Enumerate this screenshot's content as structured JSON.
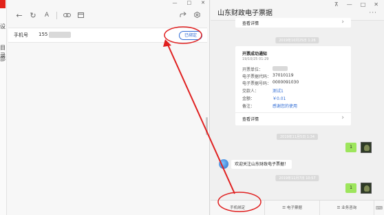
{
  "bg_app": {
    "badge_label": "",
    "side_texts": [
      "目录",
      "设",
      "部"
    ]
  },
  "left_window": {
    "controls": [
      "—",
      "□",
      "✕"
    ],
    "toolbar_icons": [
      "back-icon",
      "refresh-icon",
      "font-icon",
      "link-icon",
      "calendar-icon",
      "share-icon",
      "settings-icon"
    ],
    "phone_label": "手机号",
    "phone_value": "155",
    "bound_button": "已绑定"
  },
  "right_window": {
    "title": "山东财政电子票据",
    "controls": [
      "⊼",
      "—",
      "□",
      "✕"
    ],
    "more": "···",
    "view_detail": "查看详情",
    "time1": "2019年10月25日 1:26",
    "notice": {
      "title": "开票成功通知",
      "date": "19/10/25 01:29",
      "fields": [
        {
          "label": "开票单位：",
          "value": ""
        },
        {
          "label": "电子票据代码：",
          "value": "37010119"
        },
        {
          "label": "电子票据号码：",
          "value": "0000091030"
        },
        {
          "label": "交款人：",
          "value": "测试1"
        },
        {
          "label": "金额：",
          "value": "￥0.01"
        },
        {
          "label": "备注：",
          "value": "感谢您的使用"
        }
      ]
    },
    "time2": "2019年11月5日 1:34",
    "reply1": "1",
    "welcome": "欢迎关注山东财政电子票据！",
    "time3": "2019年11月7日 10:57",
    "reply2": "1",
    "bottom_tabs": [
      "手机绑定",
      "☰ 电子票据",
      "☰ 业务咨询"
    ],
    "keyboard_icon": "⌨"
  }
}
